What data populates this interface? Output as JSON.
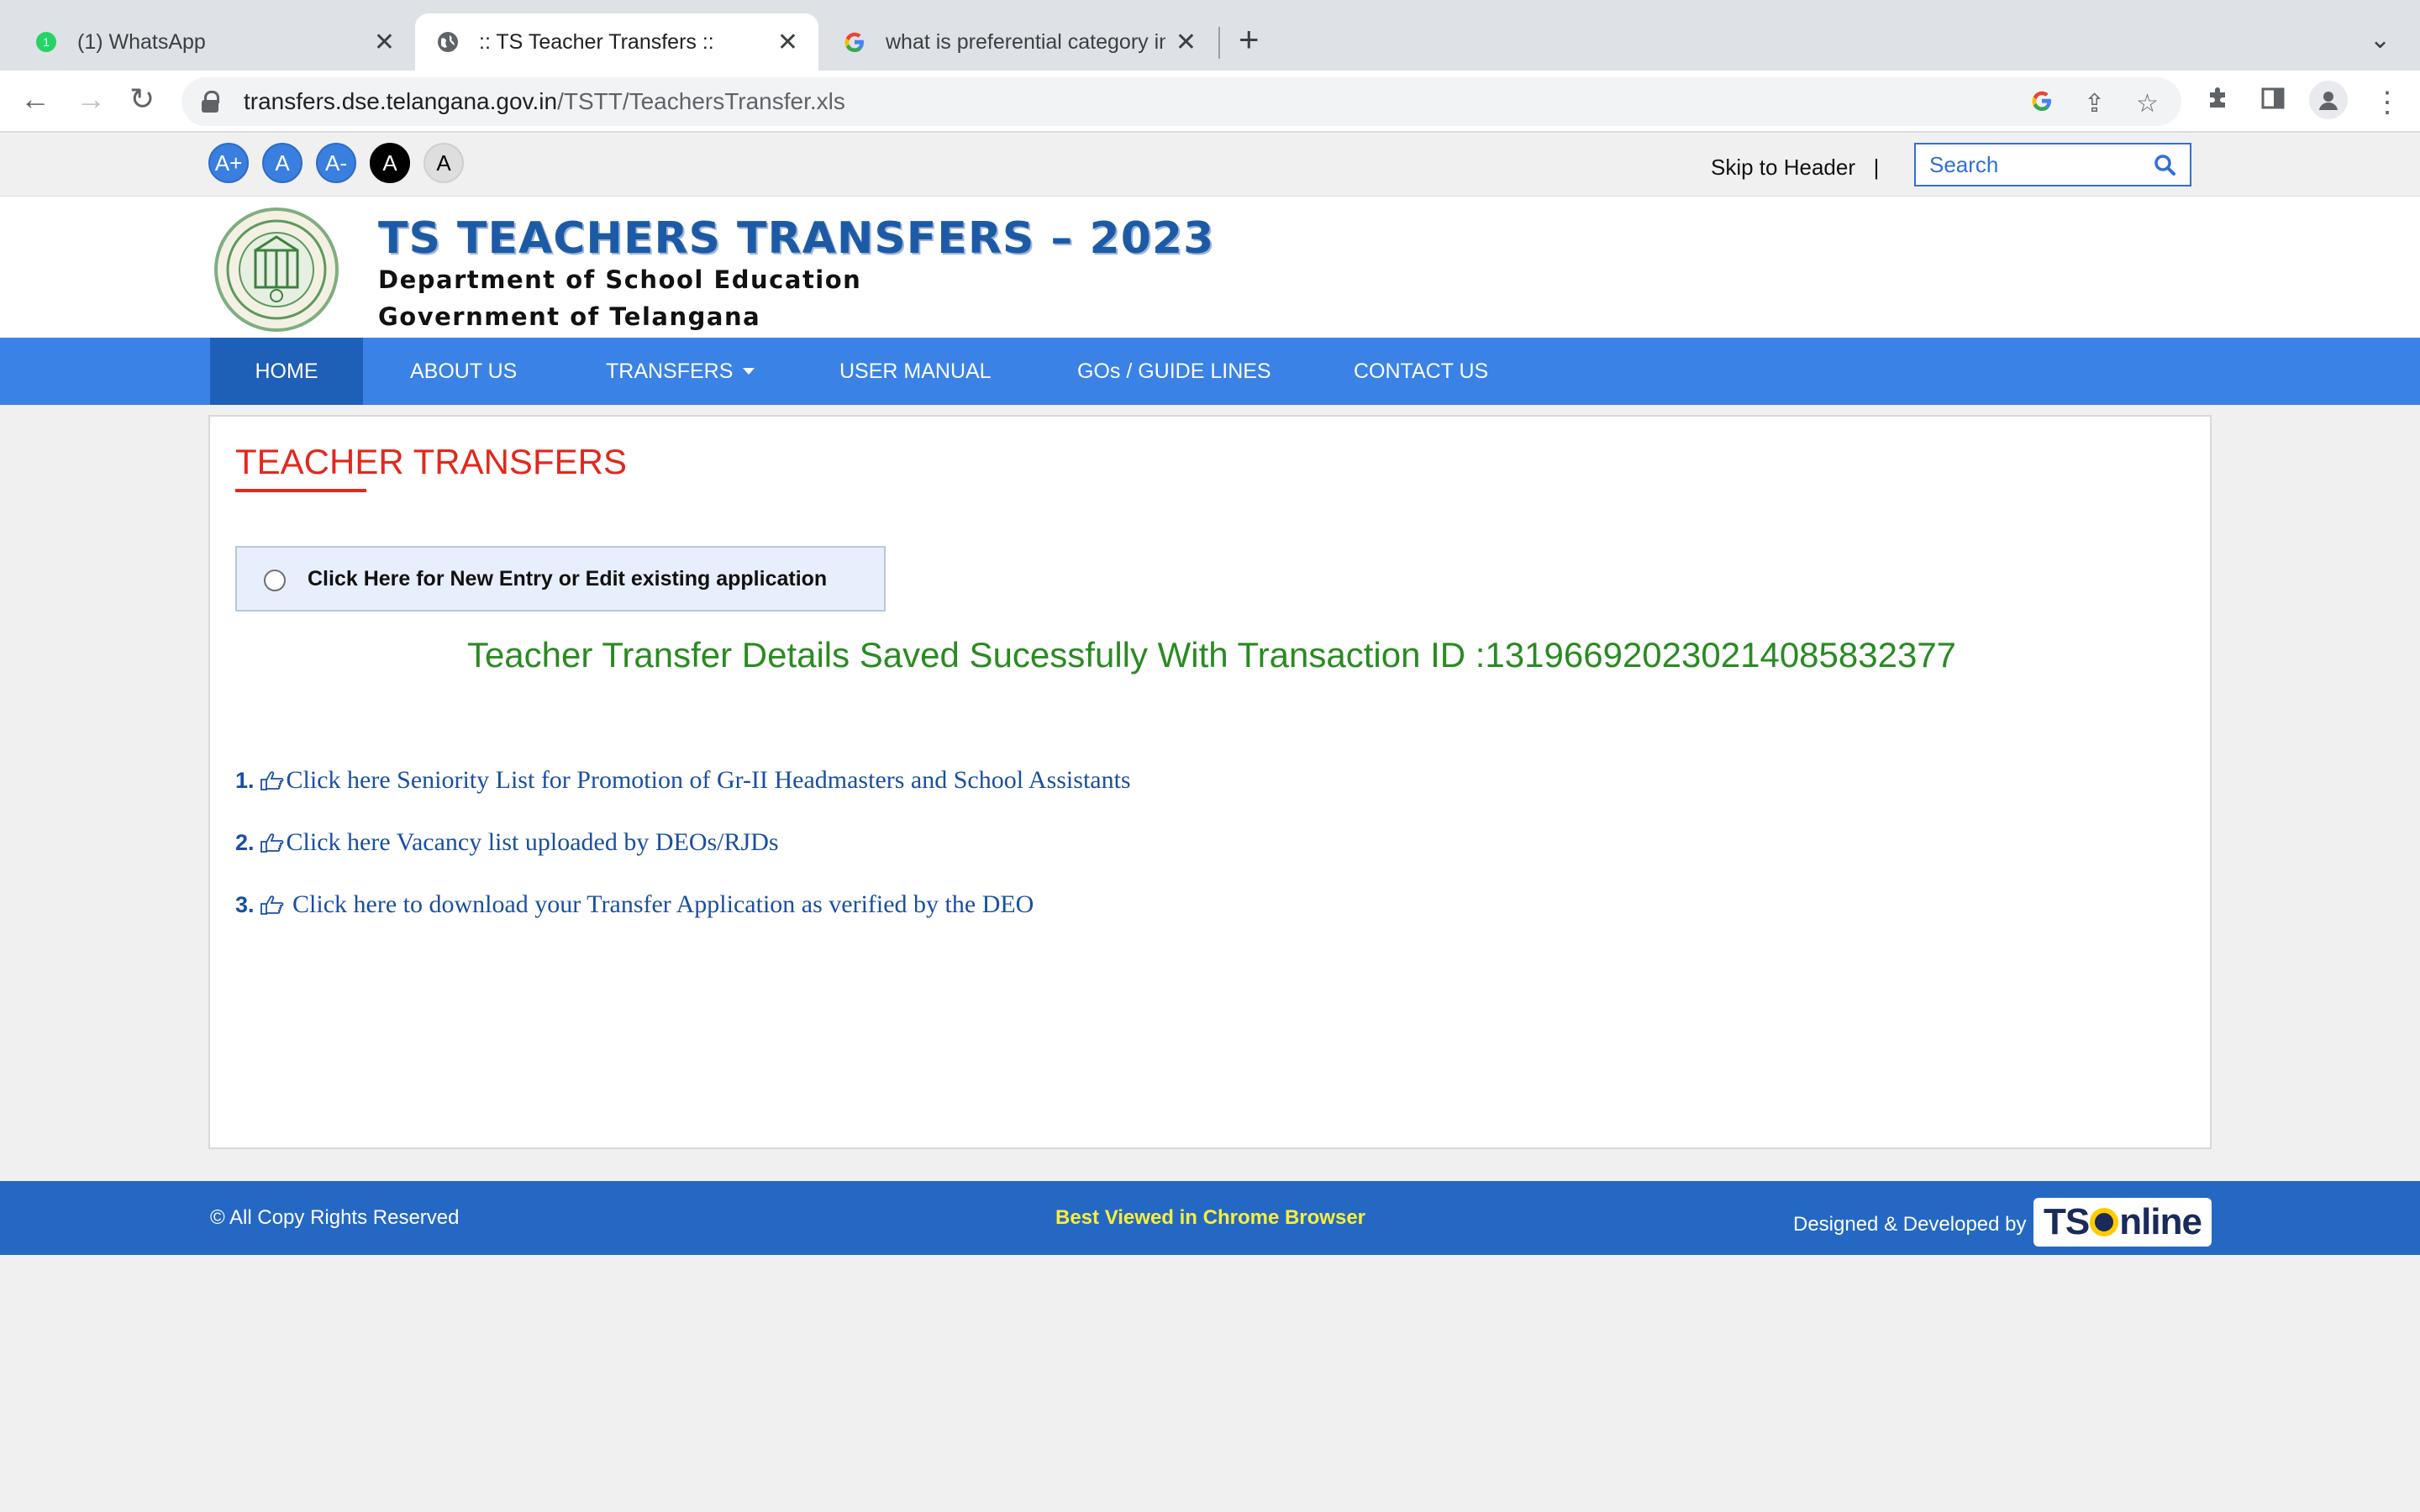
{
  "browser": {
    "tabs": [
      {
        "title": "(1) WhatsApp",
        "badge": "1",
        "icon": "whatsapp-icon"
      },
      {
        "title": ":: TS Teacher Transfers ::",
        "icon": "globe-icon"
      },
      {
        "title": "what is preferential category in",
        "icon": "google-icon"
      }
    ],
    "url_host": "transfers.dse.telangana.gov.in",
    "url_path": "/TSTT/TeachersTransfer.xls"
  },
  "accessibility": {
    "font_buttons": [
      "A+",
      "A",
      "A-",
      "A",
      "A"
    ],
    "skip_label": "Skip to Header",
    "separator": "|",
    "search_placeholder": "Search"
  },
  "header": {
    "title": "TS TEACHERS TRANSFERS – 2023",
    "subtitle1": "Department of School Education",
    "subtitle2": "Government of Telangana"
  },
  "nav": {
    "items": [
      "HOME",
      "ABOUT US",
      "TRANSFERS",
      "USER MANUAL",
      "GOs / GUIDE LINES",
      "CONTACT US"
    ]
  },
  "main": {
    "title": "TEACHER TRANSFERS",
    "entry_label": "Click Here for New Entry or Edit existing application",
    "success_message": "Teacher Transfer Details Saved Sucessfully With Transaction ID :131966920230214085832377",
    "links": [
      {
        "num": "1.",
        "text": "Click here Seniority List for Promotion of Gr-II Headmasters and School Assistants"
      },
      {
        "num": "2.",
        "text": "Click here Vacancy list uploaded by DEOs/RJDs"
      },
      {
        "num": "3.",
        "text": " Click here to download your Transfer Application as verified by the DEO"
      }
    ]
  },
  "footer": {
    "copyright": "© All Copy Rights Reserved",
    "best_viewed": "Best Viewed in Chrome Browser",
    "designed_by": "Designed & Developed by",
    "logo_text_a": "TS",
    "logo_text_b": "nline"
  },
  "colors": {
    "nav_blue": "#3a82e6",
    "title_red": "#e3271e",
    "success_green": "#2a8a22",
    "footer_blue": "#2468c4",
    "footer_yellow": "#f8ef3a"
  }
}
